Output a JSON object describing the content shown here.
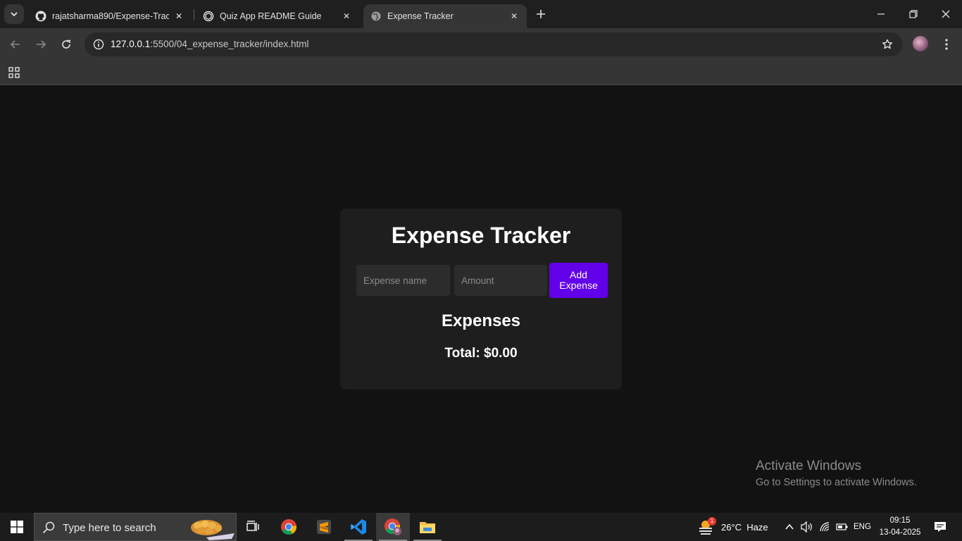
{
  "browser": {
    "tabs": [
      {
        "title": "rajatsharma890/Expense-Tracker",
        "icon": "github-icon",
        "active": false
      },
      {
        "title": "Quiz App README Guide",
        "icon": "chatgpt-icon",
        "active": false
      },
      {
        "title": "Expense Tracker",
        "icon": "globe-icon",
        "active": true
      }
    ],
    "url_host": "127.0.0.1",
    "url_path": ":5500/04_expense_tracker/index.html"
  },
  "app": {
    "title": "Expense Tracker",
    "name_placeholder": "Expense name",
    "amount_placeholder": "Amount",
    "add_button_line1": "Add",
    "add_button_line2": "Expense",
    "expenses_heading": "Expenses",
    "total_label": "Total: $0.00",
    "accent_color": "#6200ea"
  },
  "watermark": {
    "line1": "Activate Windows",
    "line2": "Go to Settings to activate Windows."
  },
  "taskbar": {
    "search_placeholder": "Type here to search",
    "apps": [
      "task-view-icon",
      "chrome-icon",
      "sublime-text-icon",
      "vscode-icon",
      "chrome-profile-icon",
      "file-explorer-icon"
    ],
    "weather_badge": "1",
    "weather": "26°C  Haze",
    "language": "ENG",
    "time": "09:15",
    "date": "13-04-2025"
  }
}
